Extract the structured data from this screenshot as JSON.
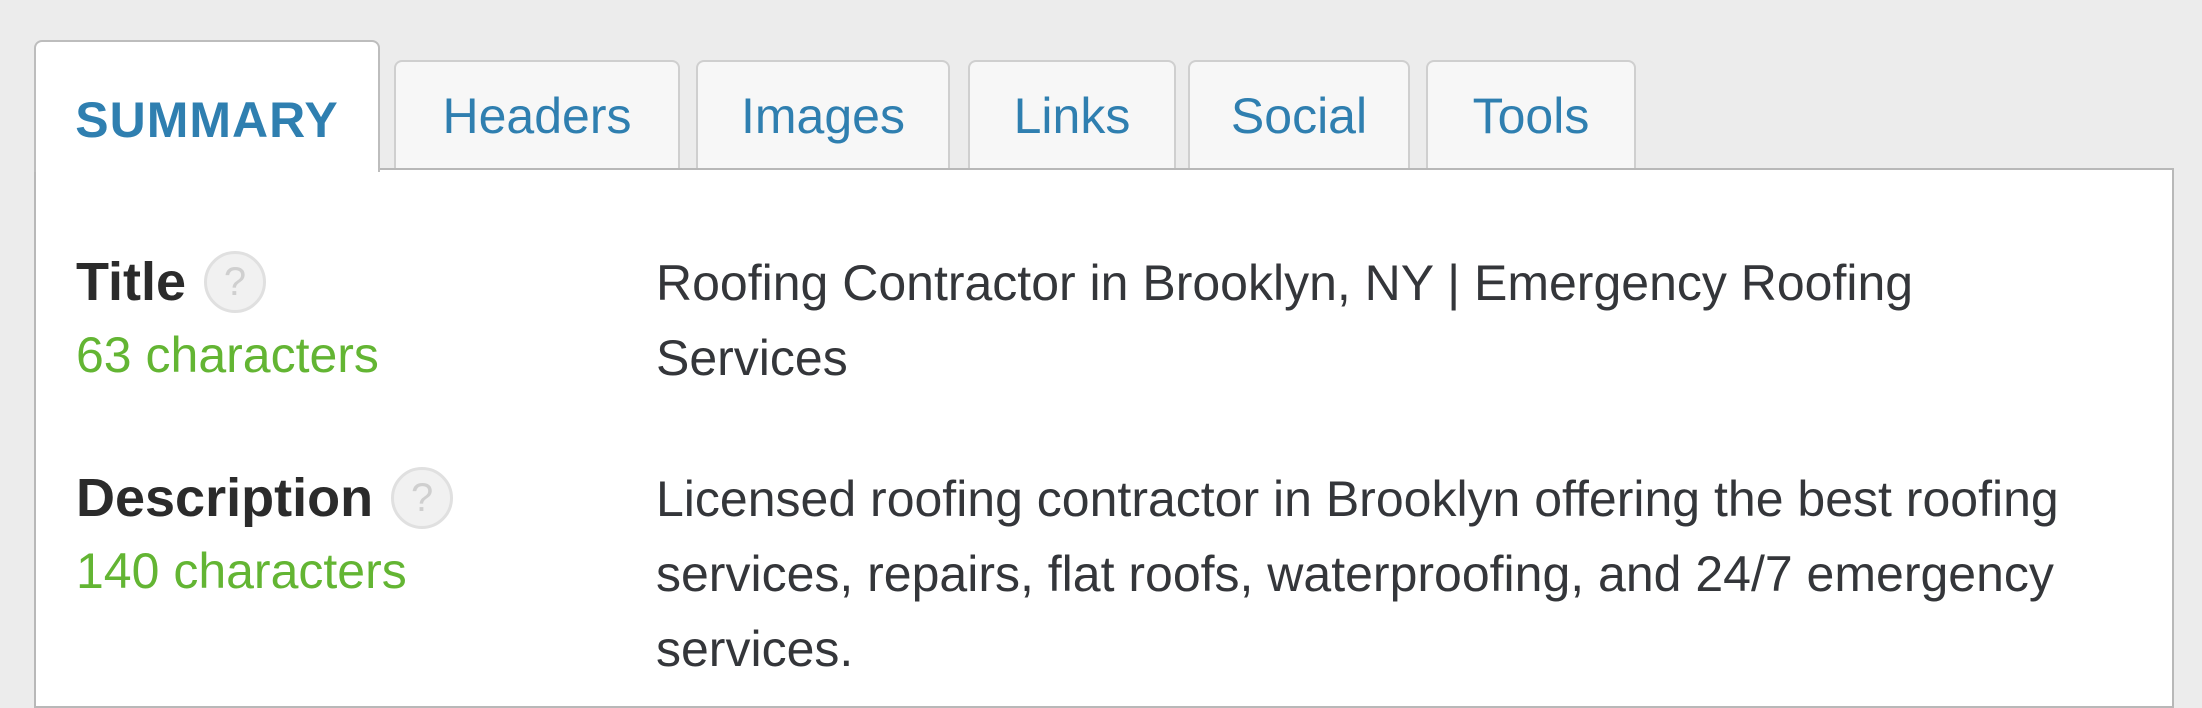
{
  "tabs": [
    {
      "label": "SUMMARY",
      "active": true
    },
    {
      "label": "Headers",
      "active": false
    },
    {
      "label": "Images",
      "active": false
    },
    {
      "label": "Links",
      "active": false
    },
    {
      "label": "Social",
      "active": false
    },
    {
      "label": "Tools",
      "active": false
    }
  ],
  "summary": {
    "title": {
      "label": "Title",
      "help_icon": "?",
      "count": "63 characters",
      "value": "Roofing Contractor in Brooklyn, NY | Emergency Roofing Services"
    },
    "description": {
      "label": "Description",
      "help_icon": "?",
      "count": "140 characters",
      "value": "Licensed roofing contractor in Brooklyn offering the best roofing services, repairs, flat roofs, waterproofing, and 24/7 emergency services."
    }
  },
  "colors": {
    "background": "#ececec",
    "tab_text": "#2f7fb0",
    "count_ok": "#63b533",
    "label": "#2b2b2b"
  }
}
